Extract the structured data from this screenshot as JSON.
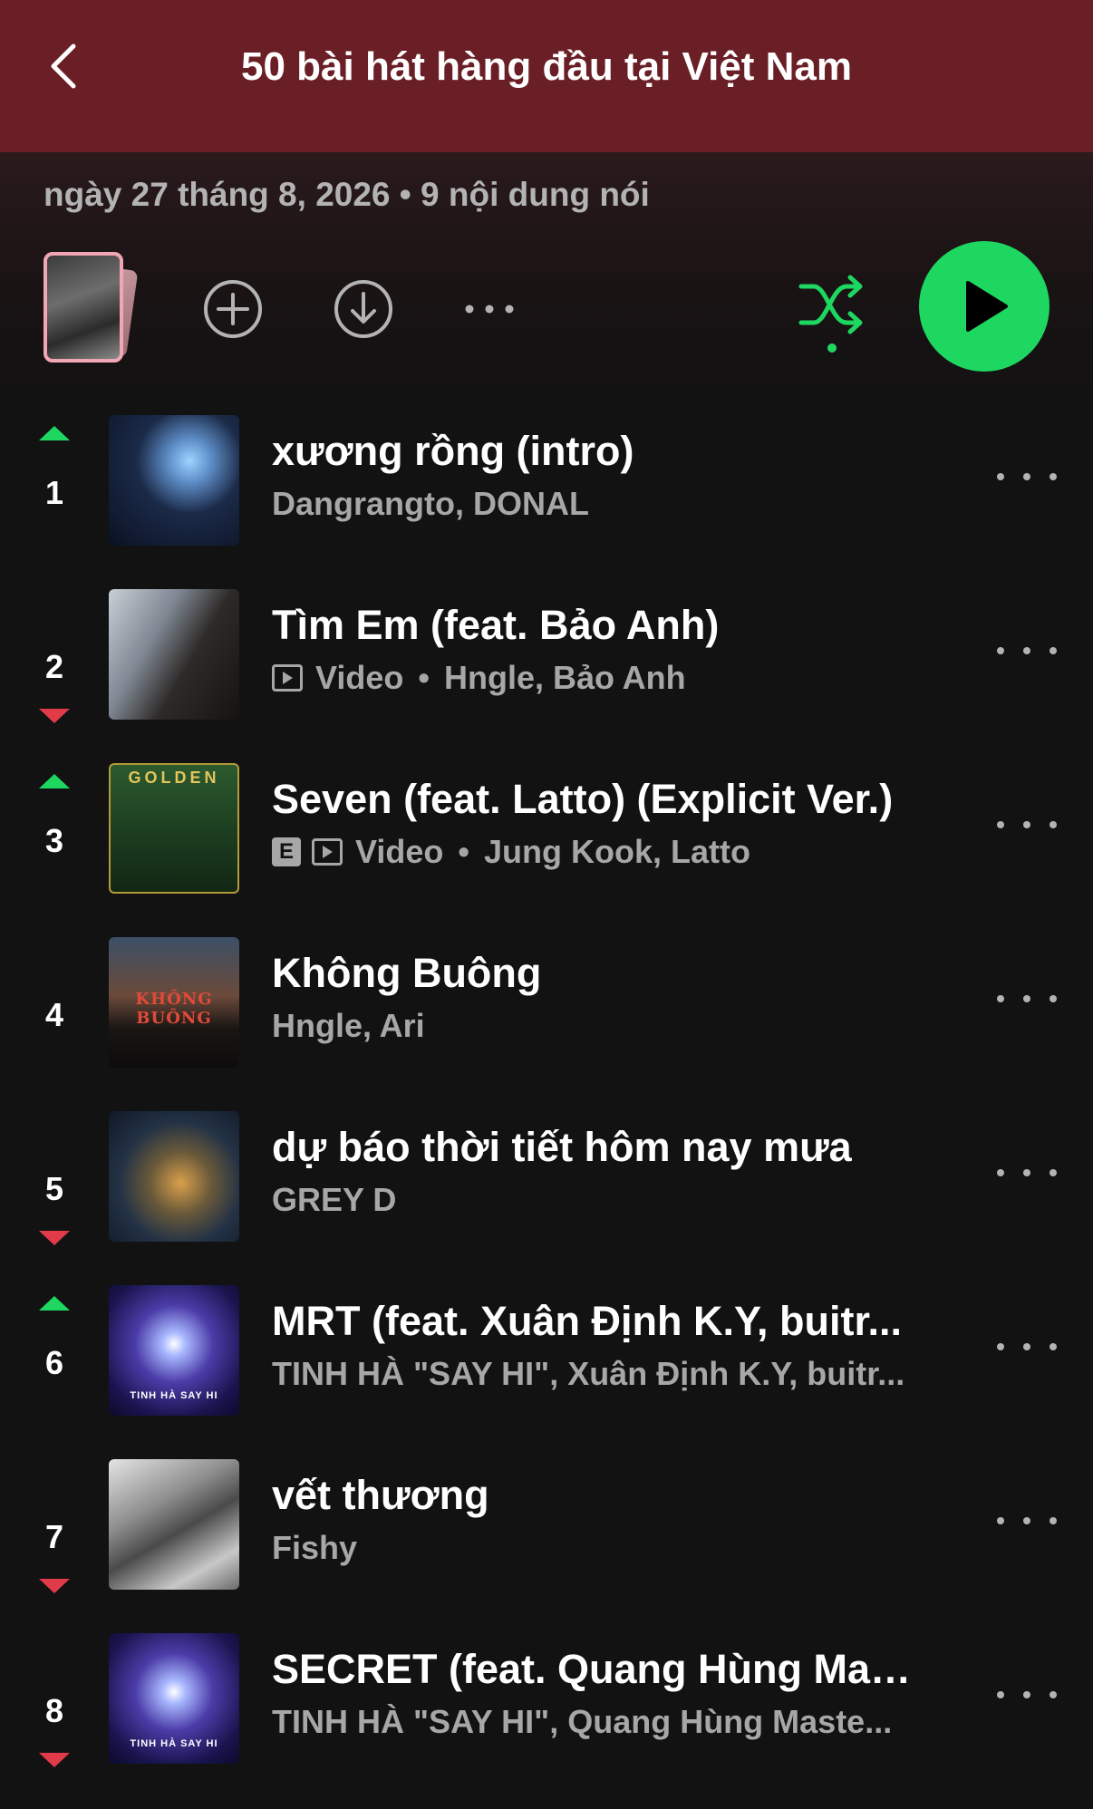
{
  "header": {
    "title": "50 bài hát hàng đầu tại Việt Nam",
    "back_icon": "chevron-left-icon",
    "background": "#6a1f26"
  },
  "meta": {
    "text": "ngày 27 tháng 8, 2026 • 9 nội dung nói"
  },
  "controls": {
    "add_icon": "plus-circle-icon",
    "download_icon": "download-circle-icon",
    "more_icon": "ellipsis-icon",
    "shuffle_icon": "shuffle-icon",
    "play_icon": "play-icon",
    "accent": "#1ed760"
  },
  "colors": {
    "trend_up": "#1ed760",
    "trend_down": "#e13b4a",
    "background": "#121212",
    "secondary_text": "#a7a7a7"
  },
  "tracks": [
    {
      "rank": "1",
      "trend": "up",
      "title": "xương rồng (intro)",
      "artists": "Dangrangto, DONAL",
      "explicit": false,
      "video": false
    },
    {
      "rank": "2",
      "trend": "down",
      "title": "Tìm Em (feat. Bảo Anh)",
      "artists": "Hngle, Bảo Anh",
      "explicit": false,
      "video": true,
      "video_label": "Video"
    },
    {
      "rank": "3",
      "trend": "up",
      "title": "Seven (feat. Latto) (Explicit Ver.)",
      "artists": "Jung Kook, Latto",
      "explicit": true,
      "explicit_label": "E",
      "video": true,
      "video_label": "Video",
      "art_text": "GOLDEN"
    },
    {
      "rank": "4",
      "trend": "none",
      "title": "Không Buông",
      "artists": "Hngle, Ari",
      "explicit": false,
      "video": false,
      "art_text": "KHÔNG BUÔNG"
    },
    {
      "rank": "5",
      "trend": "down",
      "title": "dự báo thời tiết hôm nay mưa",
      "artists": "GREY D",
      "explicit": false,
      "video": false
    },
    {
      "rank": "6",
      "trend": "up",
      "title": "MRT (feat. Xuân Định K.Y, buitr...",
      "artists": "TINH HÀ \"SAY HI\", Xuân Định K.Y, buitr...",
      "explicit": false,
      "video": false,
      "art_text": "TINH HÀ SAY HI"
    },
    {
      "rank": "7",
      "trend": "down",
      "title": "vết thương",
      "artists": "Fishy",
      "explicit": false,
      "video": false
    },
    {
      "rank": "8",
      "trend": "down",
      "title": "SECRET (feat. Quang Hùng Mas...",
      "artists": "TINH HÀ \"SAY HI\", Quang Hùng Maste...",
      "explicit": false,
      "video": false,
      "art_text": "TINH HÀ SAY HI"
    }
  ],
  "video_separator": "•"
}
